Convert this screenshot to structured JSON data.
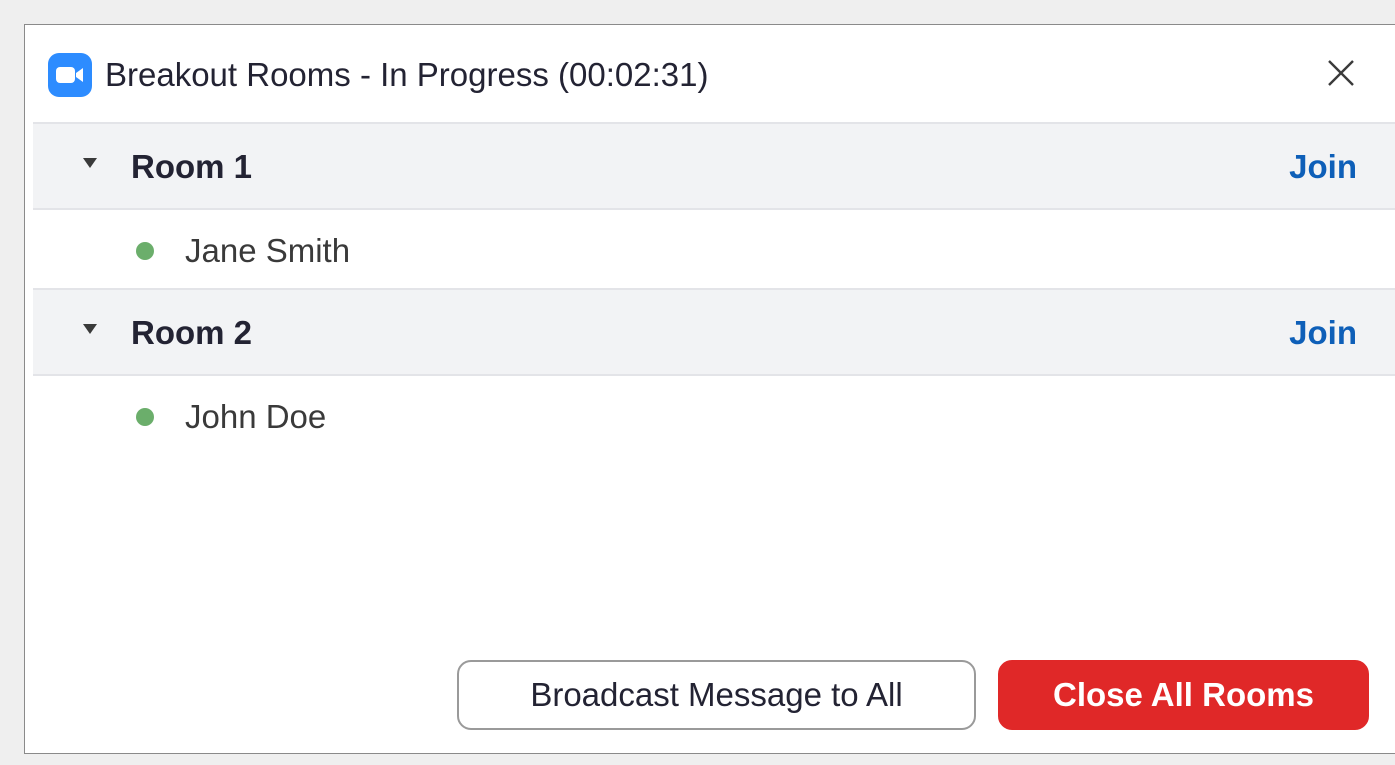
{
  "window": {
    "title": "Breakout Rooms - In Progress (00:02:31)",
    "app_icon": "zoom-camera-icon",
    "close_icon": "close-icon"
  },
  "rooms": [
    {
      "name": "Room 1",
      "join_label": "Join",
      "participants": [
        {
          "name": "Jane Smith",
          "status_color": "#6bae6b"
        }
      ]
    },
    {
      "name": "Room 2",
      "join_label": "Join",
      "participants": [
        {
          "name": "John Doe",
          "status_color": "#6bae6b"
        }
      ]
    }
  ],
  "footer": {
    "broadcast_label": "Broadcast Message to All",
    "close_all_label": "Close All Rooms"
  },
  "colors": {
    "accent_blue": "#2d8cff",
    "link_blue": "#0e5fb8",
    "danger_red": "#e02828",
    "status_green": "#6bae6b"
  }
}
